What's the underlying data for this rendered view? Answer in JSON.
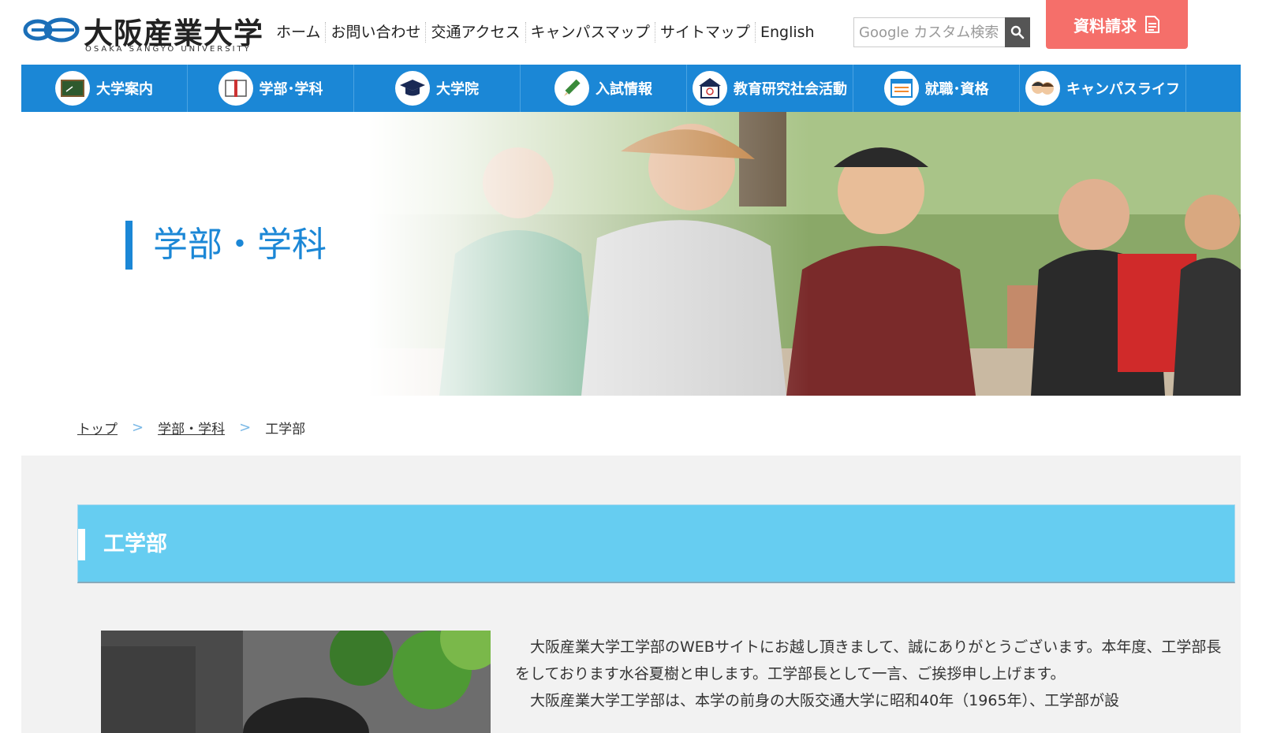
{
  "logo": {
    "name": "大阪産業大学",
    "subtitle": "OSAKA SANGYO UNIVERSITY"
  },
  "topnav": [
    {
      "label": "ホーム"
    },
    {
      "label": "お問い合わせ"
    },
    {
      "label": "交通アクセス"
    },
    {
      "label": "キャンパスマップ"
    },
    {
      "label": "サイトマップ"
    },
    {
      "label": "English"
    }
  ],
  "search": {
    "placeholder": "Google カスタム検索"
  },
  "request": {
    "label": "資料請求"
  },
  "mainnav": [
    {
      "label": "大学案内",
      "icon": "blackboard-icon"
    },
    {
      "label": "学部･学科",
      "icon": "book-icon"
    },
    {
      "label": "大学院",
      "icon": "graduation-cap-icon"
    },
    {
      "label": "入試情報",
      "icon": "pencil-icon"
    },
    {
      "label": "教育研究社会活動",
      "icon": "building-icon"
    },
    {
      "label": "就職･資格",
      "icon": "document-icon"
    },
    {
      "label": "キャンパスライフ",
      "icon": "students-icon"
    }
  ],
  "hero": {
    "title": "学部・学科"
  },
  "breadcrumb": {
    "items": [
      "トップ",
      "学部・学科",
      "工学部"
    ],
    "separator": ">"
  },
  "section": {
    "title": "工学部",
    "paragraphs": [
      "大阪産業大学工学部のWEBサイトにお越し頂きまして、誠にありがとうございます。本年度、工学部長をしております水谷夏樹と申します。工学部長として一言、ご挨拶申し上げます。",
      "大阪産業大学工学部は、本学の前身の大阪交通大学に昭和40年（1965年）、工学部が設"
    ]
  },
  "colors": {
    "primary_blue": "#1b87d6",
    "section_header": "#66cdf1",
    "request_button": "#f56f6a",
    "content_bg": "#f2f2f2"
  }
}
